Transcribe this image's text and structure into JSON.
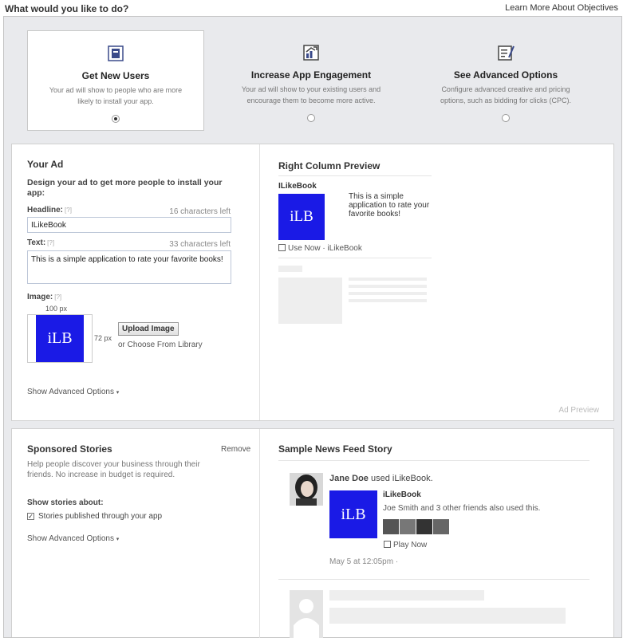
{
  "header": {
    "title": "What would you like to do?",
    "learn_more": "Learn More About Objectives"
  },
  "objectives": [
    {
      "title": "Get New Users",
      "desc": "Your ad will show to people who are more likely to install your app.",
      "icon": "users-icon",
      "selected": true
    },
    {
      "title": "Increase App Engagement",
      "desc": "Your ad will show to your existing users and encourage them to become more active.",
      "icon": "engagement-icon",
      "selected": false
    },
    {
      "title": "See Advanced Options",
      "desc": "Configure advanced creative and pricing options, such as bidding for clicks (CPC).",
      "icon": "advanced-icon",
      "selected": false
    }
  ],
  "your_ad": {
    "title": "Your Ad",
    "subtitle": "Design your ad to get more people to install your app:",
    "headline_label": "Headline:",
    "help": "[?]",
    "headline_left": "16 characters left",
    "headline_value": "ILikeBook",
    "text_label": "Text:",
    "text_left": "33 characters left",
    "text_value": "This is a simple application to rate your favorite books!",
    "image_label": "Image:",
    "width_label": "100 px",
    "height_label": "72 px",
    "thumb_text": "iLB",
    "upload_button": "Upload Image",
    "choose_library": "or Choose From Library",
    "advanced": "Show Advanced Options",
    "caret": "▾"
  },
  "preview": {
    "title": "Right Column Preview",
    "ad_name": "ILikeBook",
    "thumb_text": "iLB",
    "ad_text": "This is a simple application to rate your favorite books!",
    "use_now": "Use Now",
    "use_now_sep": " · ",
    "use_now_app": "iLikeBook",
    "footer": "Ad Preview"
  },
  "sponsored": {
    "title": "Sponsored Stories",
    "remove": "Remove",
    "desc": "Help people discover your business through their friends. No increase in budget is required.",
    "show_about": "Show stories about:",
    "checkbox_label": "Stories published through your app",
    "checked": true,
    "advanced": "Show Advanced Options",
    "caret": "▾"
  },
  "newsfeed": {
    "title": "Sample News Feed Story",
    "user": "Jane Doe",
    "used": "used",
    "app": "iLikeBook.",
    "app_title": "iLikeBook",
    "thumb_text": "iLB",
    "friend": "Joe Smith",
    "and": "and",
    "others": "3 other friends",
    "also": "also used this.",
    "play_now": "Play Now",
    "timestamp": "May 5 at 12:05pm ·"
  }
}
